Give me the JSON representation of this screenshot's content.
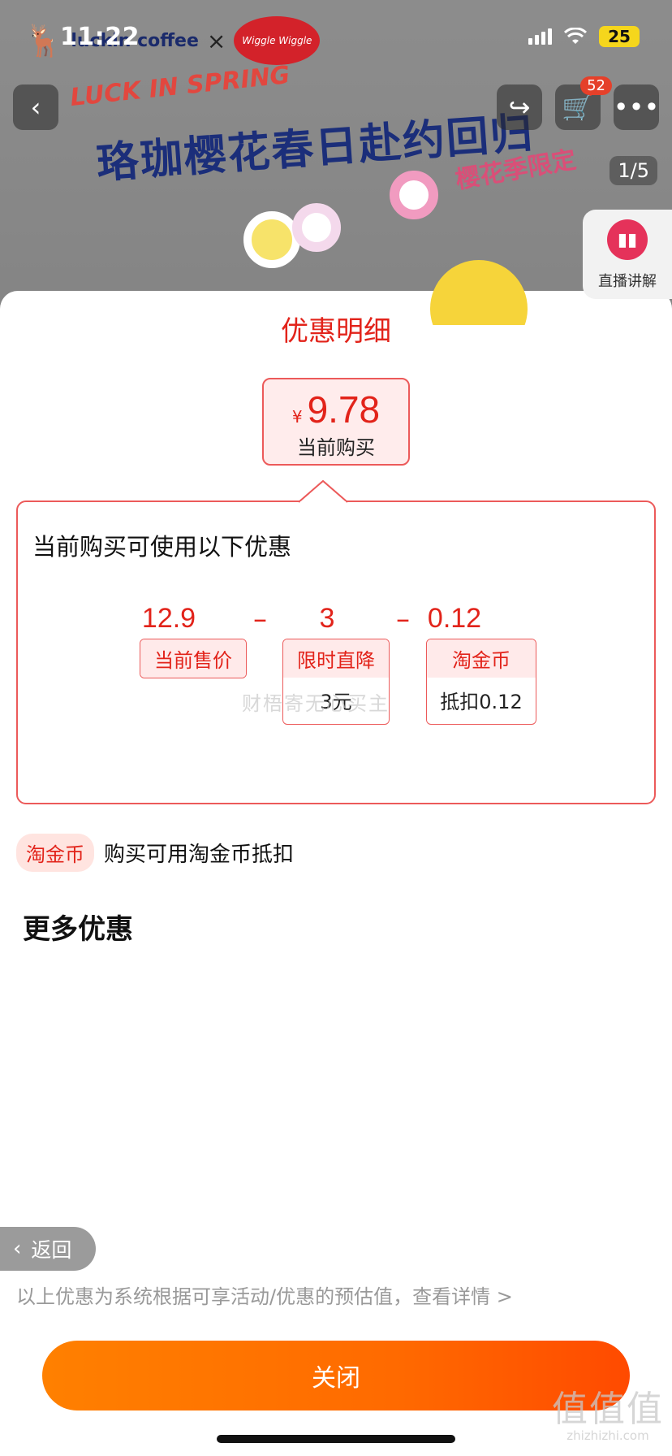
{
  "status_bar": {
    "time": "11:22",
    "battery": "25"
  },
  "background_page": {
    "brand_left": "luckin coffee",
    "brand_x": "×",
    "brand_right": "Wiggle Wiggle",
    "cart_count": "52",
    "banner_en": "LUCK IN SPRING",
    "banner_title": "珞珈樱花春日赴约回归",
    "banner_tag": "樱花季限定",
    "page_indicator": "1/5",
    "live_label": "直播讲解"
  },
  "sheet": {
    "title": "优惠明细",
    "price": {
      "currency": "¥",
      "value": "9.78",
      "caption": "当前购买"
    },
    "detail": {
      "heading": "当前购买可使用以下优惠",
      "terms": [
        {
          "value": "12.9",
          "label": "当前售价",
          "sub": ""
        },
        {
          "value": "3",
          "label": "限时直降",
          "sub": "3元"
        },
        {
          "value": "0.12",
          "label": "淘金币",
          "sub": "抵扣0.12"
        }
      ],
      "operators": [
        "–",
        "–"
      ],
      "watermark": "财梧寄无心买主"
    },
    "coin_row": {
      "badge": "淘金币",
      "text": "购买可用淘金币抵扣"
    },
    "more_title": "更多优惠",
    "back_label": "返回",
    "disclaimer": "以上优惠为系统根据可享活动/优惠的预估值，查看详情 >",
    "close_label": "关闭"
  },
  "site_mark": {
    "big": "值值值",
    "small": "zhizhizhi.com"
  },
  "colors": {
    "accent": "#e2231a",
    "button_start": "#ff8000",
    "button_end": "#ff4a00"
  }
}
